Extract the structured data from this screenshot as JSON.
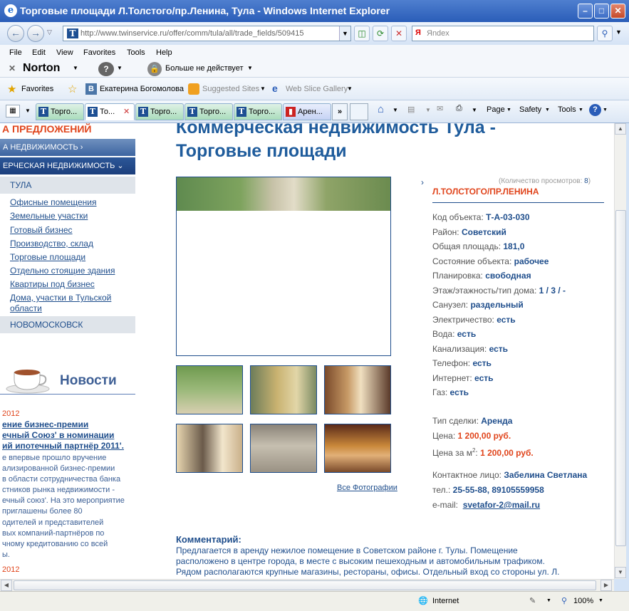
{
  "window": {
    "title": "Торговые площади Л.Толстого/пр.Ленина, Тула - Windows Internet Explorer",
    "app_icon": "e"
  },
  "nav": {
    "url": "http://www.twinservice.ru/offer/comm/tula/all/trade_fields/509415",
    "search_placeholder": "Яndex"
  },
  "menu": [
    "File",
    "Edit",
    "View",
    "Favorites",
    "Tools",
    "Help"
  ],
  "norton": {
    "label": "Norton",
    "extra": "Больше не действует"
  },
  "favorites": {
    "label": "Favorites",
    "items": [
      "Екатерина Богомолова",
      "Suggested Sites",
      "Web Slice Gallery"
    ]
  },
  "tabs": [
    "Торго...",
    "То...",
    "Торго...",
    "Торго...",
    "Торго...",
    "Арен..."
  ],
  "commands": [
    "Page",
    "Safety",
    "Tools"
  ],
  "left": {
    "header": "А ПРЕДЛОЖЕНИЙ",
    "bar1": "А НЕДВИЖИМОСТЬ",
    "bar2": "ЕРЧЕСКАЯ НЕДВИЖИМОСТЬ",
    "city1": "ТУЛА",
    "links": [
      "Офисные помещения",
      "Земельные участки",
      "Готовый бизнес",
      "Производство, склад",
      "Торговые площади",
      "Отдельно стоящие здания",
      "Квартиры под бизнес",
      "Дома, участки в Тульской области"
    ],
    "city2": "НОВОМОСКОВСК",
    "news_heading": "Новости",
    "news": [
      {
        "date": "2012",
        "title": [
          "ение бизнес-премии",
          "ечный Союз' в номинации",
          "ий ипотечный партнёр 2011'."
        ],
        "text": [
          "е впервые прошло вручение",
          "ализированной бизнес-премии",
          "в области сотрудничества банка",
          "стников рынка недвижимости -",
          "ечный союз'. На это мероприятие",
          "приглашены более 80",
          "одителей и представителей",
          "вых компаний-партнёров по",
          "чному кредитованию со всей",
          "ы."
        ]
      },
      {
        "date": "2012"
      }
    ]
  },
  "main": {
    "heading1": "Коммерческая недвижимость Тула -",
    "heading2": "Торговые площади",
    "all_photos": "Все Фотографии",
    "views_label": "(Количество просмотров:",
    "views_count": "8",
    "object_title": "Л.ТОЛСТОГО/ПР.ЛЕНИНА",
    "props": [
      {
        "k": "Код объекта:",
        "v": "Т-А-03-030"
      },
      {
        "k": "Район:",
        "v": "Советский"
      },
      {
        "k": "Общая площадь:",
        "v": "181,0"
      },
      {
        "k": "Состояние объекта:",
        "v": "рабочее"
      },
      {
        "k": "Планировка:",
        "v": "свободная"
      },
      {
        "k": "Этаж/этажность/тип дома:",
        "v": "1 / 3 / -"
      },
      {
        "k": "Санузел:",
        "v": "раздельный"
      },
      {
        "k": "Электричество:",
        "v": "есть"
      },
      {
        "k": "Вода:",
        "v": "есть"
      },
      {
        "k": "Канализация:",
        "v": "есть"
      },
      {
        "k": "Телефон:",
        "v": "есть"
      },
      {
        "k": "Интернет:",
        "v": "есть"
      },
      {
        "k": "Газ:",
        "v": "есть"
      }
    ],
    "deal": {
      "k": "Тип сделки:",
      "v": "Аренда"
    },
    "price": {
      "k": "Цена:",
      "v": "1 200,00 руб."
    },
    "price_m2": {
      "k": "Цена за м",
      "sup": "2",
      "v": "1 200,00 руб."
    },
    "contact": {
      "k": "Контактное лицо:",
      "v": "Забелина Светлана"
    },
    "phone": {
      "k": "тел.:",
      "v": "25-55-88, 89105559958"
    },
    "email": {
      "k": "e-mail:",
      "v": "svetafor-2@mail.ru"
    },
    "comment_heading": "Комментарий:",
    "comment": [
      "Предлагается в аренду нежилое помещение в Советском районе г. Тулы. Помещение",
      "расположено в центре города, в  месте с высоким пешеходным и автомобильным трафиком.",
      "Рядом располагаются крупные магазины, рестораны, офисы. Отдельный вход со стороны ул. Л."
    ]
  },
  "status": {
    "zone": "Internet",
    "zoom": "100%"
  }
}
